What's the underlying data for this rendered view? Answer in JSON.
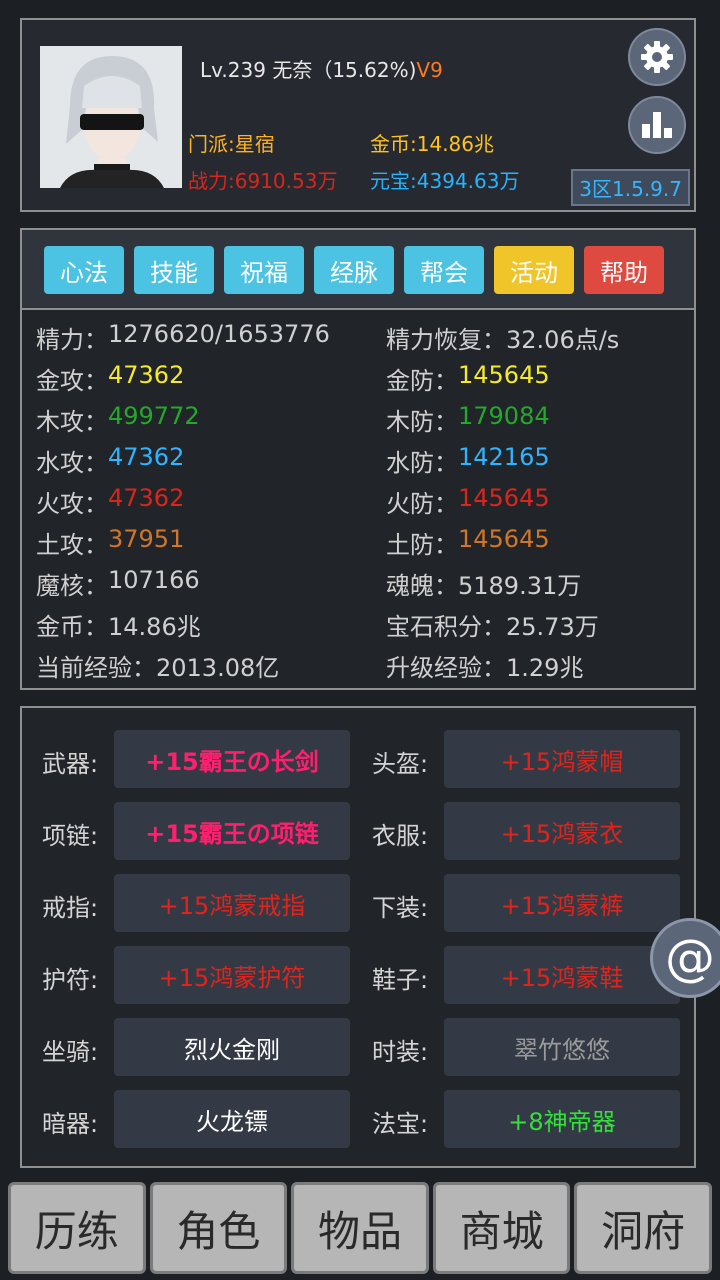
{
  "profile": {
    "level_line": "Lv.239 无奈（15.62%)",
    "vip": "V9",
    "sect_label": "门派:",
    "sect": "星宿",
    "power_label": "战力:",
    "power": "6910.53万",
    "gold_label": "金币:",
    "gold": "14.86兆",
    "yuanbao_label": "元宝:",
    "yuanbao": "4394.63万",
    "version": "3区1.5.9.7",
    "colors": {
      "sect": "#ffb21f",
      "power": "#d9261c",
      "gold": "#ffc21f",
      "yuanbao": "#27b4ff"
    }
  },
  "tabs": [
    {
      "label": "心法",
      "color": "#4cc3e3"
    },
    {
      "label": "技能",
      "color": "#4cc3e3"
    },
    {
      "label": "祝福",
      "color": "#4cc3e3"
    },
    {
      "label": "经脉",
      "color": "#4cc3e3"
    },
    {
      "label": "帮会",
      "color": "#4cc3e3"
    },
    {
      "label": "活动",
      "color": "#f0c52a"
    },
    {
      "label": "帮助",
      "color": "#de4a40"
    }
  ],
  "stats": {
    "left": [
      {
        "label": "精力：",
        "value": "1276620/1653776",
        "color": "#d0d0d0"
      },
      {
        "label": "金攻：",
        "value": "47362",
        "color": "#f4ea2a"
      },
      {
        "label": "木攻：",
        "value": "499772",
        "color": "#22a82a"
      },
      {
        "label": "水攻：",
        "value": "47362",
        "color": "#2fb4ff"
      },
      {
        "label": "火攻：",
        "value": "47362",
        "color": "#d9261c"
      },
      {
        "label": "土攻：",
        "value": "37951",
        "color": "#d0762a"
      },
      {
        "label": "魔核：",
        "value": "107166",
        "color": "#d0d0d0"
      },
      {
        "label": "金币：",
        "value": "14.86兆",
        "color": "#d0d0d0"
      },
      {
        "label": "当前经验：",
        "value": "2013.08亿",
        "color": "#d0d0d0"
      }
    ],
    "right": [
      {
        "label": "精力恢复：",
        "value": "32.06点/s",
        "color": "#d0d0d0"
      },
      {
        "label": "金防：",
        "value": "145645",
        "color": "#f4ea2a"
      },
      {
        "label": "木防：",
        "value": "179084",
        "color": "#22a82a"
      },
      {
        "label": "水防：",
        "value": "142165",
        "color": "#2fb4ff"
      },
      {
        "label": "火防：",
        "value": "145645",
        "color": "#d9261c"
      },
      {
        "label": "土防：",
        "value": "145645",
        "color": "#d0762a"
      },
      {
        "label": "魂魄：",
        "value": "5189.31万",
        "color": "#d0d0d0"
      },
      {
        "label": "宝石积分：",
        "value": "25.73万",
        "color": "#d0d0d0"
      },
      {
        "label": "升级经验：",
        "value": "1.29兆",
        "color": "#d0d0d0"
      }
    ]
  },
  "equipment": [
    {
      "label": "武器:",
      "item": "+15霸王の长剑",
      "color": "#ff1f6e",
      "bold": true
    },
    {
      "label": "头盔:",
      "item": "+15鸿蒙帽",
      "color": "#e0241c",
      "bold": false
    },
    {
      "label": "项链:",
      "item": "+15霸王の项链",
      "color": "#ff1f6e",
      "bold": true
    },
    {
      "label": "衣服:",
      "item": "+15鸿蒙衣",
      "color": "#e0241c",
      "bold": false
    },
    {
      "label": "戒指:",
      "item": "+15鸿蒙戒指",
      "color": "#e0241c",
      "bold": false
    },
    {
      "label": "下装:",
      "item": "+15鸿蒙裤",
      "color": "#e0241c",
      "bold": false
    },
    {
      "label": "护符:",
      "item": "+15鸿蒙护符",
      "color": "#e0241c",
      "bold": false
    },
    {
      "label": "鞋子:",
      "item": "+15鸿蒙鞋",
      "color": "#e0241c",
      "bold": false
    },
    {
      "label": "坐骑:",
      "item": "烈火金刚",
      "color": "#ffffff",
      "bold": false
    },
    {
      "label": "时装:",
      "item": "翠竹悠悠",
      "color": "#9a9a9a",
      "bold": false
    },
    {
      "label": "暗器:",
      "item": "火龙镖",
      "color": "#ffffff",
      "bold": false
    },
    {
      "label": "法宝:",
      "item": "+8神帝器",
      "color": "#33e03a",
      "bold": false
    }
  ],
  "nav": [
    "历练",
    "角色",
    "物品",
    "商城",
    "洞府"
  ],
  "icons": {
    "settings": "gear-icon",
    "ranking": "bar-chart-icon",
    "chat": "at-icon"
  }
}
